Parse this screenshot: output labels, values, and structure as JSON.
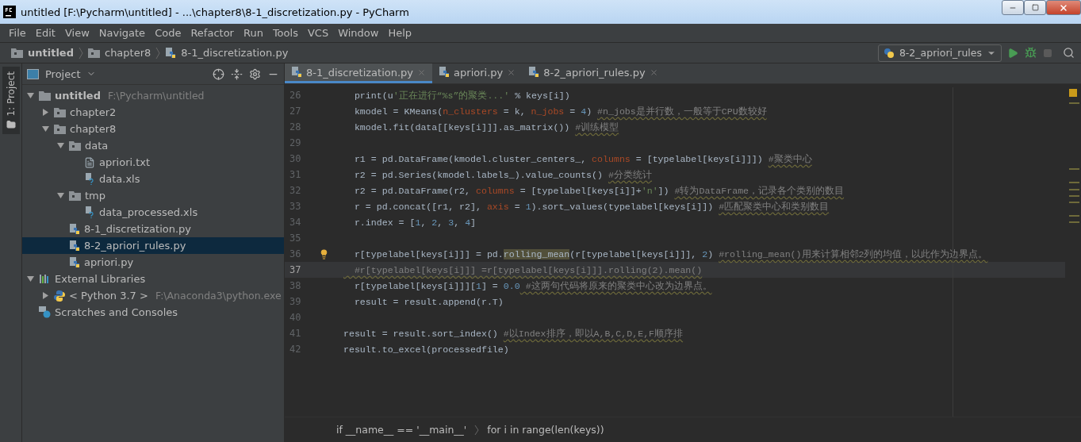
{
  "window": {
    "title": "untitled [F:\\Pycharm\\untitled] - ...\\chapter8\\8-1_discretization.py - PyCharm"
  },
  "menu": [
    "File",
    "Edit",
    "View",
    "Navigate",
    "Code",
    "Refactor",
    "Run",
    "Tools",
    "VCS",
    "Window",
    "Help"
  ],
  "breadcrumbs": [
    {
      "label": "untitled",
      "kind": "root"
    },
    {
      "label": "chapter8",
      "kind": "folder"
    },
    {
      "label": "8-1_discretization.py",
      "kind": "python"
    }
  ],
  "run_config": {
    "label": "8-2_apriori_rules"
  },
  "side_strip": {
    "label": "1: Project",
    "selected": true
  },
  "project_panel": {
    "title": "Project",
    "tree": [
      {
        "label": "untitled",
        "path": "F:\\Pycharm\\untitled",
        "kind": "root",
        "expanded": true,
        "selected": false,
        "children": [
          {
            "label": "chapter2",
            "kind": "folder",
            "expanded": false,
            "selected": false
          },
          {
            "label": "chapter8",
            "kind": "folder",
            "expanded": true,
            "selected": false,
            "children": [
              {
                "label": "data",
                "kind": "folder",
                "expanded": true,
                "selected": false,
                "children": [
                  {
                    "label": "apriori.txt",
                    "kind": "text",
                    "selected": false
                  },
                  {
                    "label": "data.xls",
                    "kind": "unknown",
                    "selected": false
                  }
                ]
              },
              {
                "label": "tmp",
                "kind": "folder",
                "expanded": true,
                "selected": false,
                "children": [
                  {
                    "label": "data_processed.xls",
                    "kind": "unknown",
                    "selected": false
                  }
                ]
              },
              {
                "label": "8-1_discretization.py",
                "kind": "python",
                "selected": false
              },
              {
                "label": "8-2_apriori_rules.py",
                "kind": "python",
                "selected": true
              },
              {
                "label": "apriori.py",
                "kind": "python",
                "selected": false
              }
            ]
          }
        ]
      },
      {
        "label": "External Libraries",
        "kind": "library",
        "expanded": true,
        "selected": false,
        "children": [
          {
            "label": "< Python 3.7 >",
            "path": "F:\\Anaconda3\\python.exe",
            "kind": "sdk",
            "expanded": false,
            "selected": false
          }
        ]
      },
      {
        "label": "Scratches and Consoles",
        "kind": "scratch",
        "selected": false
      }
    ]
  },
  "tabs": [
    {
      "label": "8-1_discretization.py",
      "selected": true
    },
    {
      "label": "apriori.py",
      "selected": false
    },
    {
      "label": "8-2_apriori_rules.py",
      "selected": false
    }
  ],
  "code": [
    {
      "number": "26",
      "current": false,
      "tokens": [
        {
          "kind": "code",
          "text": "  print(u"
        },
        {
          "kind": "string",
          "text": "'正在进行“%s”的聚类...'"
        },
        {
          "kind": "code",
          "text": " % keys[i])"
        }
      ]
    },
    {
      "number": "27",
      "current": false,
      "tokens": [
        {
          "kind": "code",
          "text": "  kmodel = KMeans("
        },
        {
          "kind": "param",
          "text": "n_clusters"
        },
        {
          "kind": "code",
          "text": " = k, "
        },
        {
          "kind": "param",
          "text": "n_jobs"
        },
        {
          "kind": "code",
          "text": " = "
        },
        {
          "kind": "number",
          "text": "4"
        },
        {
          "kind": "code",
          "text": ") "
        },
        {
          "kind": "comment",
          "text": "#n_jobs是并行数，一般等于CPU数较好"
        }
      ]
    },
    {
      "number": "28",
      "current": false,
      "tokens": [
        {
          "kind": "code",
          "text": "  kmodel.fit(data[[keys[i]]].as_matrix()) "
        },
        {
          "kind": "comment",
          "text": "#训练模型"
        }
      ]
    },
    {
      "number": "29",
      "current": false
    },
    {
      "number": "30",
      "current": false,
      "tokens": [
        {
          "kind": "code",
          "text": "  r1 = pd.DataFrame(kmodel.cluster_centers_, "
        },
        {
          "kind": "param",
          "text": "columns"
        },
        {
          "kind": "code",
          "text": " = [typelabel[keys[i]]]) "
        },
        {
          "kind": "comment",
          "text": "#聚类中心"
        }
      ]
    },
    {
      "number": "31",
      "current": false,
      "tokens": [
        {
          "kind": "code",
          "text": "  r2 = pd.Series(kmodel.labels_).value_counts() "
        },
        {
          "kind": "comment",
          "text": "#分类统计"
        }
      ]
    },
    {
      "number": "32",
      "current": false,
      "tokens": [
        {
          "kind": "code",
          "text": "  r2 = pd.DataFrame(r2, "
        },
        {
          "kind": "param",
          "text": "columns"
        },
        {
          "kind": "code",
          "text": " = [typelabel[keys[i]]+"
        },
        {
          "kind": "string",
          "text": "'n'"
        },
        {
          "kind": "code",
          "text": "]) "
        },
        {
          "kind": "comment",
          "text": "#转为DataFrame，记录各个类别的数目"
        }
      ]
    },
    {
      "number": "33",
      "current": false,
      "tokens": [
        {
          "kind": "code",
          "text": "  r = pd.concat([r1, r2], "
        },
        {
          "kind": "param",
          "text": "axis"
        },
        {
          "kind": "code",
          "text": " = "
        },
        {
          "kind": "number",
          "text": "1"
        },
        {
          "kind": "code",
          "text": ").sort_values(typelabel[keys[i]]) "
        },
        {
          "kind": "comment",
          "text": "#匹配聚类中心和类别数目"
        }
      ]
    },
    {
      "number": "34",
      "current": false,
      "tokens": [
        {
          "kind": "code",
          "text": "  r.index = ["
        },
        {
          "kind": "number",
          "text": "1"
        },
        {
          "kind": "code",
          "text": ", "
        },
        {
          "kind": "number",
          "text": "2"
        },
        {
          "kind": "code",
          "text": ", "
        },
        {
          "kind": "number",
          "text": "3"
        },
        {
          "kind": "code",
          "text": ", "
        },
        {
          "kind": "number",
          "text": "4"
        },
        {
          "kind": "code",
          "text": "]"
        }
      ]
    },
    {
      "number": "35",
      "current": false
    },
    {
      "number": "36",
      "current": false,
      "bulb": true,
      "tokens": [
        {
          "kind": "code",
          "text": "  r[typelabel[keys[i]]] = pd."
        },
        {
          "kind": "highlight",
          "text": "rolling_mean"
        },
        {
          "kind": "code",
          "text": "(r[typelabel[keys[i]]], "
        },
        {
          "kind": "number",
          "text": "2"
        },
        {
          "kind": "code",
          "text": ") "
        },
        {
          "kind": "comment",
          "text": "#rolling_mean()用来计算相邻2列的均值，以此作为边界点。"
        }
      ]
    },
    {
      "number": "37",
      "current": true,
      "tokens": [
        {
          "kind": "comment",
          "text": "  #r[typelabel[keys[i]]] =r[typelabel[keys[i]]].rolling(2).mean()"
        }
      ]
    },
    {
      "number": "38",
      "current": false,
      "tokens": [
        {
          "kind": "code",
          "text": "  r[typelabel[keys[i]]]["
        },
        {
          "kind": "number",
          "text": "1"
        },
        {
          "kind": "code",
          "text": "] = "
        },
        {
          "kind": "number",
          "text": "0.0"
        },
        {
          "kind": "comment",
          "text": " #这两句代码将原来的聚类中心改为边界点。"
        }
      ]
    },
    {
      "number": "39",
      "current": false,
      "tokens": [
        {
          "kind": "code",
          "text": "  result = result.append(r.T)"
        }
      ]
    },
    {
      "number": "40",
      "current": false
    },
    {
      "number": "41",
      "current": false,
      "tokens": [
        {
          "kind": "code",
          "text": "result = result.sort_index() "
        },
        {
          "kind": "comment",
          "text": "#以Index排序，即以A,B,C,D,E,F顺序排"
        }
      ]
    },
    {
      "number": "42",
      "current": false,
      "tokens": [
        {
          "kind": "code",
          "text": "result.to_excel(processedfile)"
        }
      ]
    }
  ],
  "code_breadcrumbs": [
    "if __name__ == '__main__'",
    "for i in range(len(keys))"
  ]
}
